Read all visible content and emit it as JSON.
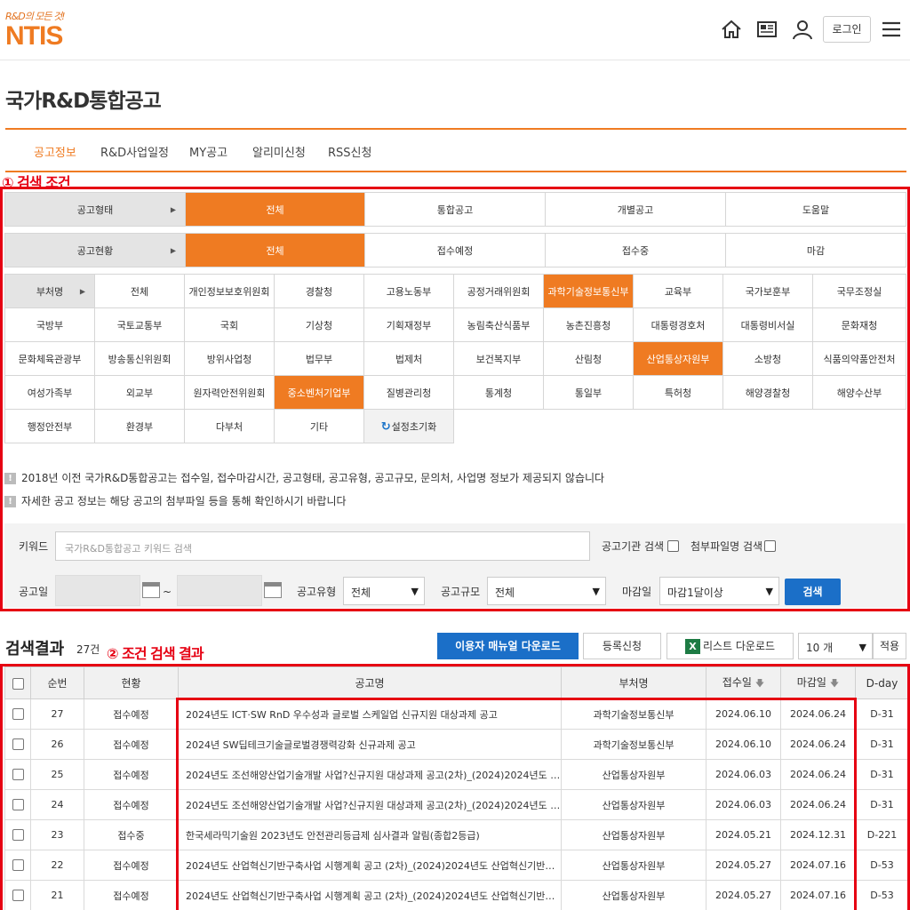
{
  "header": {
    "slogan": "R&D의 모든 것!",
    "logo": "NTIS",
    "login": "로그인",
    "icons": [
      "home-icon",
      "news-icon",
      "user-icon",
      "menu-icon"
    ]
  },
  "page_title": "국가R&D통합공고",
  "tabs": [
    "공고정보",
    "R&D사업일정",
    "MY공고",
    "알리미신청",
    "RSS신청"
  ],
  "annotations": {
    "search_conditions": "① 검색 조건",
    "search_results": "② 조건 검색 결과"
  },
  "filters": {
    "type": {
      "label": "공고형태",
      "options": [
        "전체",
        "통합공고",
        "개별공고",
        "도움말"
      ]
    },
    "status": {
      "label": "공고현황",
      "options": [
        "전체",
        "접수예정",
        "접수중",
        "마감"
      ]
    },
    "ministry": {
      "label": "부처명",
      "rows": [
        [
          "전체",
          "개인정보보호위원회",
          "경찰청",
          "고용노동부",
          "공정거래위원회",
          "과학기술정보통신부",
          "교육부",
          "국가보훈부",
          "국무조정실"
        ],
        [
          "국방부",
          "국토교통부",
          "국회",
          "기상청",
          "기획재정부",
          "농림축산식품부",
          "농촌진흥청",
          "대통령경호처",
          "대통령비서실",
          "문화재청"
        ],
        [
          "문화체육관광부",
          "방송통신위원회",
          "방위사업청",
          "법무부",
          "법제처",
          "보건복지부",
          "산림청",
          "산업통상자원부",
          "소방청",
          "식품의약품안전처"
        ],
        [
          "여성가족부",
          "외교부",
          "원자력안전위원회",
          "중소벤처기업부",
          "질병관리청",
          "통계청",
          "통일부",
          "특허청",
          "해양경찰청",
          "해양수산부"
        ],
        [
          "행정안전부",
          "환경부",
          "다부처",
          "기타"
        ]
      ],
      "reset": "설정초기화"
    }
  },
  "notes": [
    "2018년 이전 국가R&D통합공고는 접수일, 접수마감시간, 공고형태, 공고유형, 공고규모, 문의처, 사업명 정보가 제공되지 않습니다",
    "자세한 공고 정보는 해당 공고의 첨부파일 등을 통해 확인하시기 바랍니다"
  ],
  "search": {
    "keyword_label": "키워드",
    "keyword_placeholder": "국가R&D통합공고 키워드 검색",
    "agency_search": "공고기관 검색",
    "attach_search": "첨부파일명 검색",
    "date_label": "공고일",
    "tilde": "~",
    "type_label": "공고유형",
    "type_value": "전체",
    "scale_label": "공고규모",
    "scale_value": "전체",
    "deadline_label": "마감일",
    "deadline_value": "마감1달이상",
    "button": "검색"
  },
  "results": {
    "title": "검색결과",
    "count": "27건",
    "manual_btn": "이용자 매뉴얼 다운로드",
    "register_btn": "등록신청",
    "list_btn": "리스트 다운로드",
    "xls_icon": "X",
    "page_size": "10 개",
    "apply_btn": "적용",
    "columns": [
      "순번",
      "현황",
      "공고명",
      "부처명",
      "접수일",
      "마감일",
      "D-day"
    ],
    "rows": [
      {
        "no": "27",
        "status": "접수예정",
        "title": "2024년도 ICT·SW RnD 우수성과 글로벌 스케일업 신규지원 대상과제 공고",
        "ministry": "과학기술정보통신부",
        "start": "2024.06.10",
        "end": "2024.06.24",
        "dday": "D-31"
      },
      {
        "no": "26",
        "status": "접수예정",
        "title": "2024년 SW딥테크기술글로벌경쟁력강화 신규과제 공고",
        "ministry": "과학기술정보통신부",
        "start": "2024.06.10",
        "end": "2024.06.24",
        "dday": "D-31"
      },
      {
        "no": "25",
        "status": "접수예정",
        "title": "2024년도 조선해양산업기술개발 사업?신규지원 대상과제 공고(2차)_(2024)2024년도 …",
        "ministry": "산업통상자원부",
        "start": "2024.06.03",
        "end": "2024.06.24",
        "dday": "D-31"
      },
      {
        "no": "24",
        "status": "접수예정",
        "title": "2024년도 조선해양산업기술개발 사업?신규지원 대상과제 공고(2차)_(2024)2024년도 …",
        "ministry": "산업통상자원부",
        "start": "2024.06.03",
        "end": "2024.06.24",
        "dday": "D-31"
      },
      {
        "no": "23",
        "status": "접수중",
        "title": "한국세라믹기술원 2023년도 안전관리등급제 심사결과 알림(종합2등급)",
        "ministry": "산업통상자원부",
        "start": "2024.05.21",
        "end": "2024.12.31",
        "dday": "D-221"
      },
      {
        "no": "22",
        "status": "접수예정",
        "title": "2024년도 산업혁신기반구축사업 시행계획 공고 (2차)_(2024)2024년도 산업혁신기반구…",
        "ministry": "산업통상자원부",
        "start": "2024.05.27",
        "end": "2024.07.16",
        "dday": "D-53"
      },
      {
        "no": "21",
        "status": "접수예정",
        "title": "2024년도 산업혁신기반구축사업 시행계획 공고 (2차)_(2024)2024년도 산업혁신기반구…",
        "ministry": "산업통상자원부",
        "start": "2024.05.27",
        "end": "2024.07.16",
        "dday": "D-53"
      }
    ]
  },
  "colors": {
    "accent": "#ef7b22",
    "annotation_red": "#e60012",
    "primary_blue": "#1b6fc8"
  }
}
